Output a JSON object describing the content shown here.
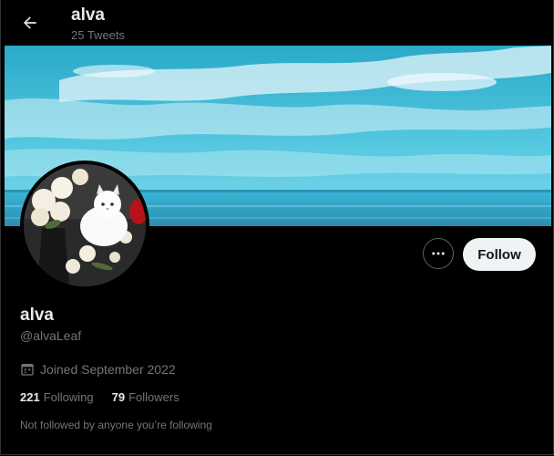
{
  "header": {
    "name": "alva",
    "tweet_count": "25 Tweets",
    "back_icon": "arrow-left-icon"
  },
  "profile": {
    "display_name": "alva",
    "handle": "@alvaLeaf",
    "joined": "Joined September 2022",
    "following_count": "221",
    "following_label": "Following",
    "followers_count": "79",
    "followers_label": "Followers",
    "followed_by": "Not followed by anyone you’re following"
  },
  "actions": {
    "more_icon": "more-horizontal-icon",
    "follow_label": "Follow"
  },
  "colors": {
    "background": "#000000",
    "primary_text": "#e7e9ea",
    "secondary_text": "#71767b",
    "follow_button_bg": "#eff3f4",
    "banner_sky": "#4cc4dc"
  }
}
